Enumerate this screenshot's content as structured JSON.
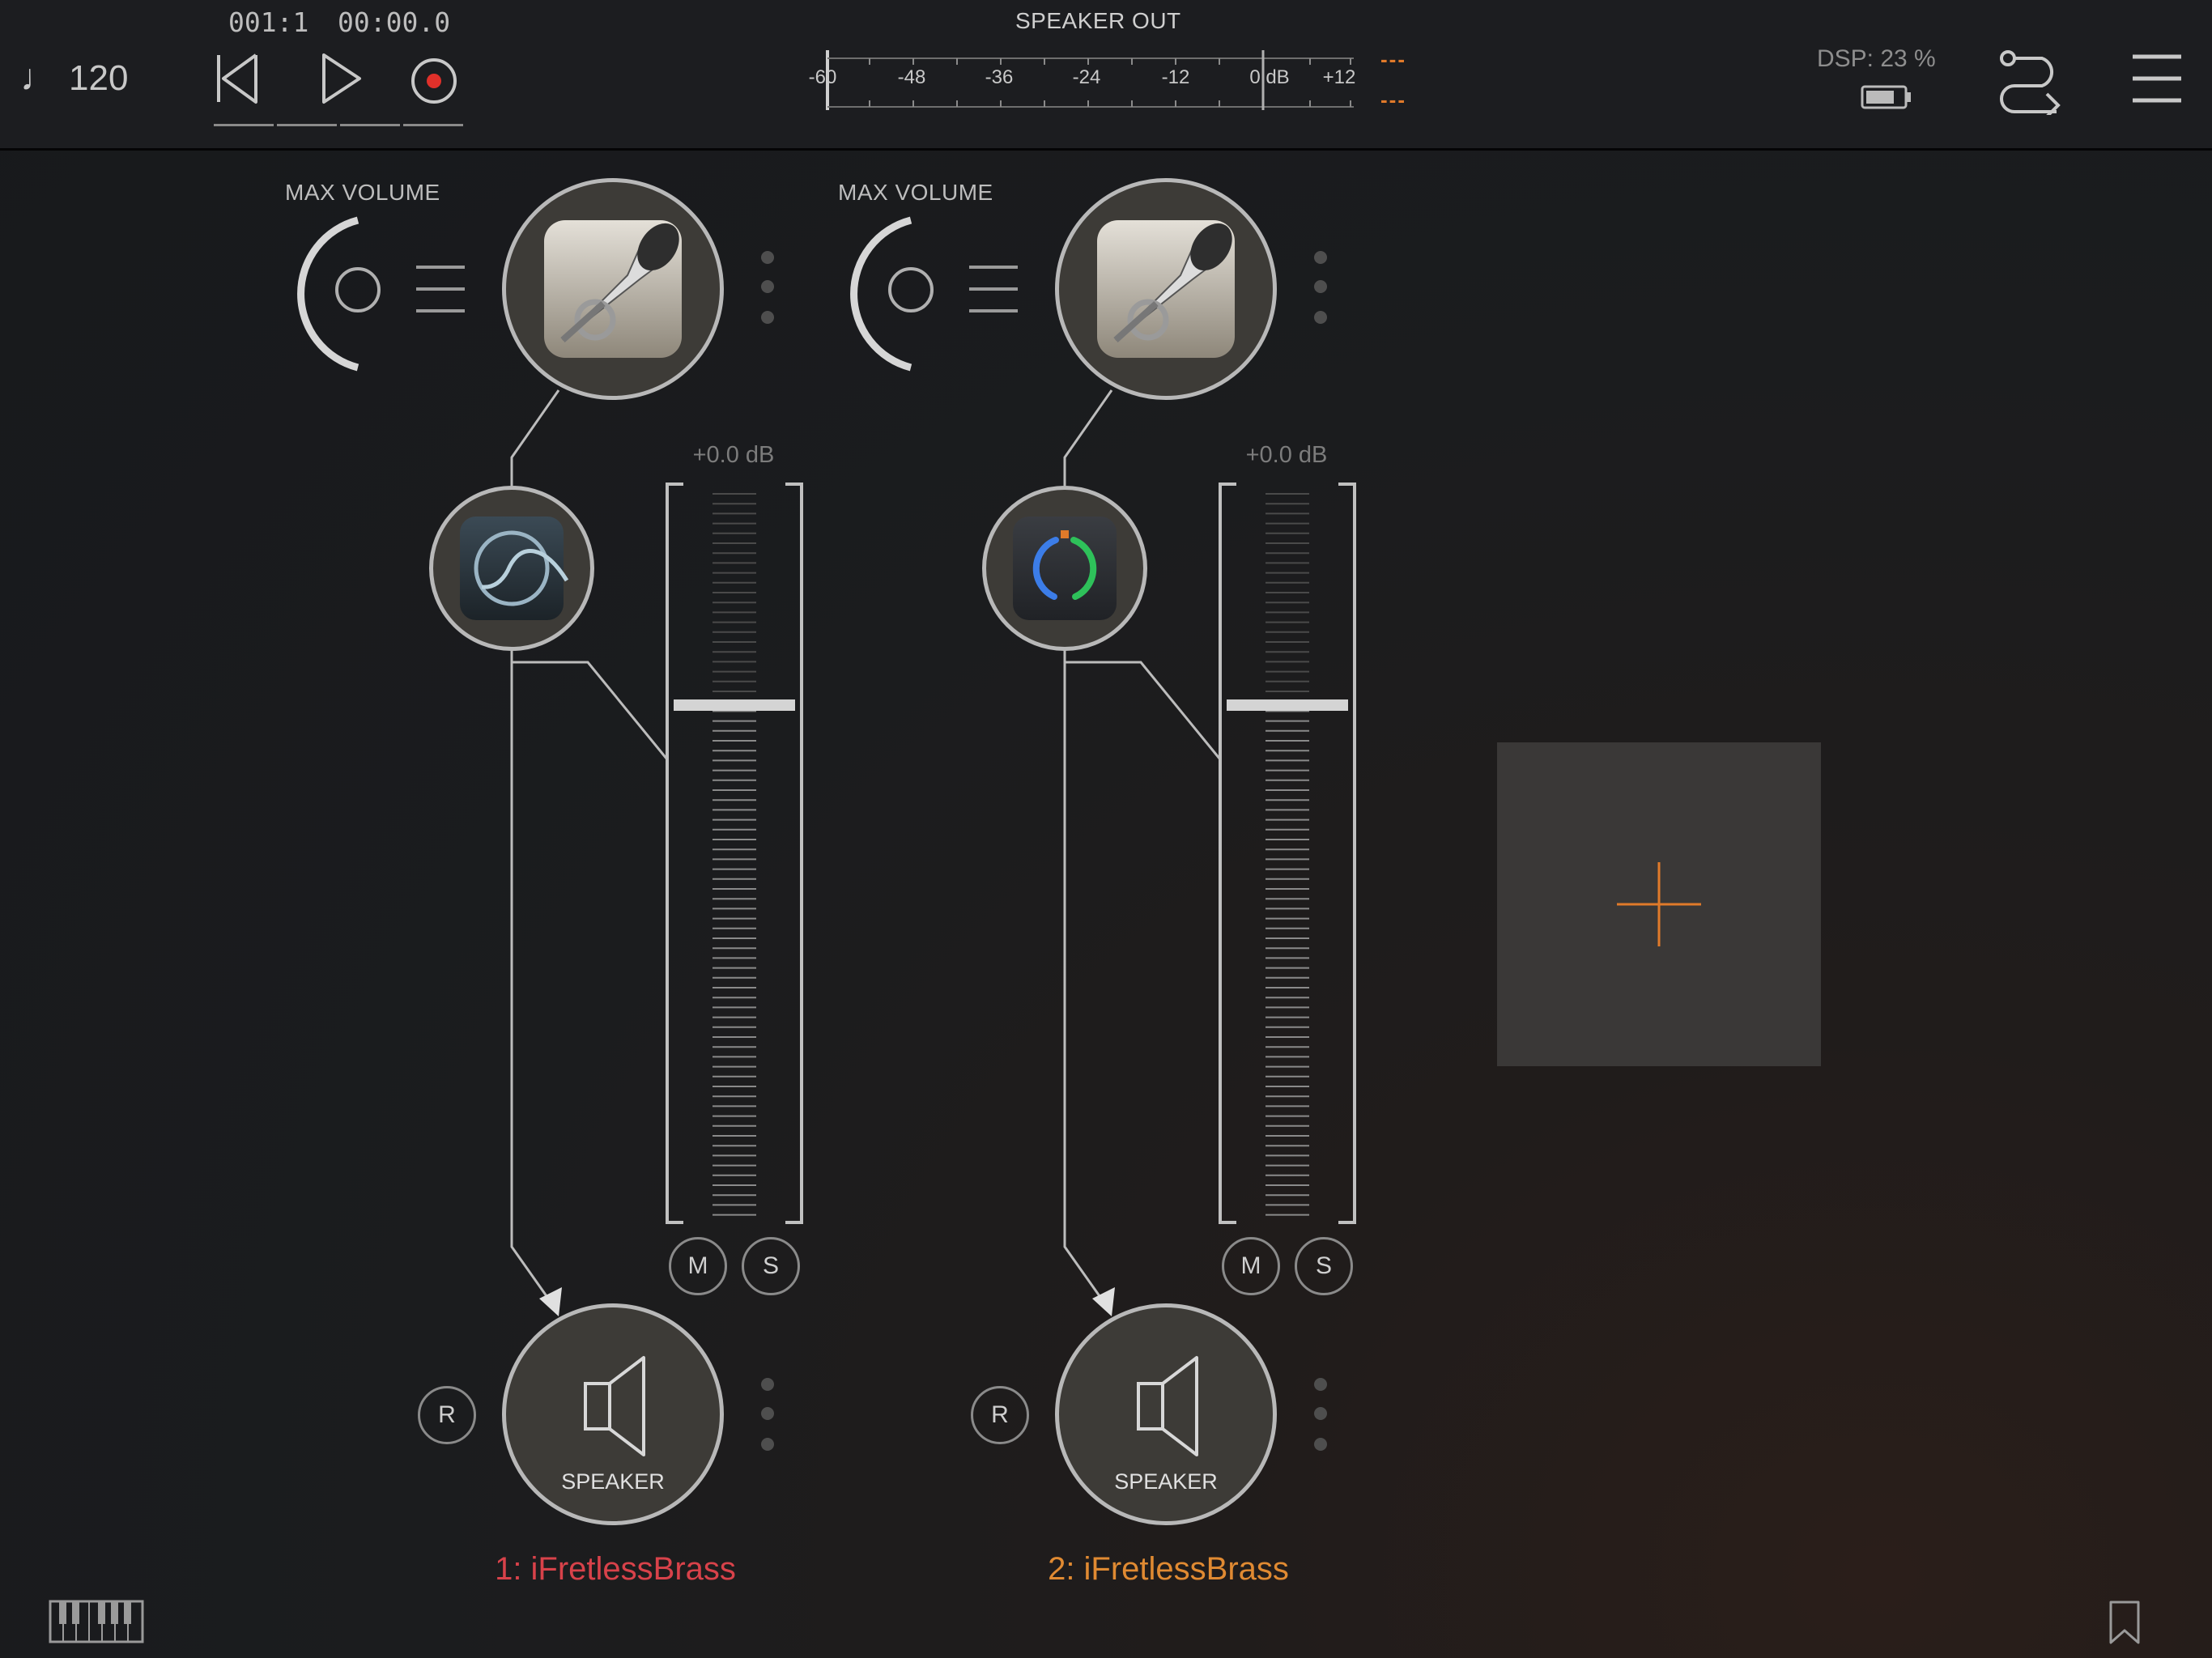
{
  "transport": {
    "tempo_symbol": "♩",
    "tempo": "120",
    "bar_position": "001:1",
    "time": "00:00.0",
    "record_color": "#e0302a"
  },
  "meter": {
    "title": "SPEAKER OUT",
    "scale": [
      "-60",
      "-48",
      "-36",
      "-24",
      "-12",
      "0 dB",
      "+12"
    ],
    "peak_left": "---",
    "peak_right": "---",
    "peak_color": "#e07a2a"
  },
  "status": {
    "dsp": "DSP: 23 %"
  },
  "icons": {
    "rewind": "rewind-icon",
    "play": "play-icon",
    "record": "record-icon",
    "battery": "battery-icon",
    "routing": "routing-icon",
    "menu": "hamburger-menu-icon",
    "keyboard": "piano-keyboard-icon",
    "bookmark": "bookmark-icon",
    "add": "plus-icon"
  },
  "channels": [
    {
      "max_volume_label": "MAX VOLUME",
      "instrument_icon": "trumpet-icon",
      "effect_icon": "filter-curve-icon",
      "gain": "+0.0 dB",
      "mute": "M",
      "solo": "S",
      "record": "R",
      "output_label": "SPEAKER",
      "name": "1: iFretlessBrass",
      "name_color": "#d8424a"
    },
    {
      "max_volume_label": "MAX VOLUME",
      "instrument_icon": "trumpet-icon",
      "effect_icon": "compressor-knob-icon",
      "gain": "+0.0 dB",
      "mute": "M",
      "solo": "S",
      "record": "R",
      "output_label": "SPEAKER",
      "name": "2: iFretlessBrass",
      "name_color": "#e08a32"
    }
  ]
}
